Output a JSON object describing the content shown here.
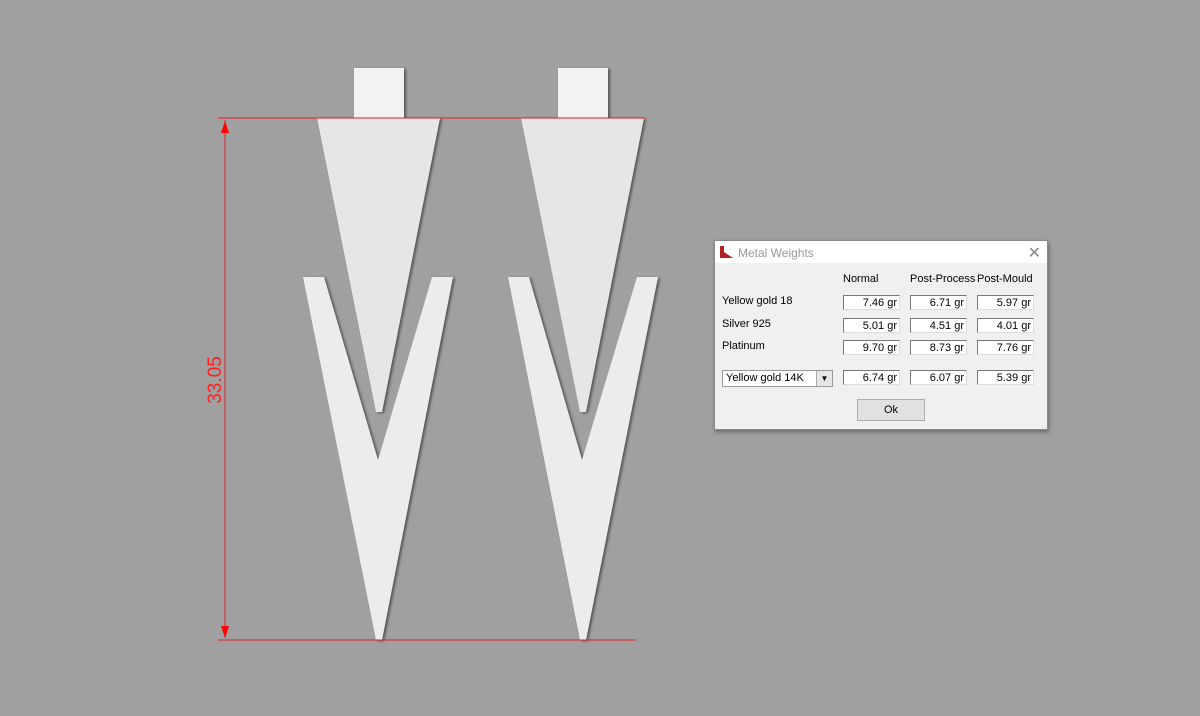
{
  "dimension": {
    "value": "33.05",
    "color": "#ff0000"
  },
  "dialog": {
    "title": "Metal Weights",
    "columns": [
      "Normal",
      "Post-Process",
      "Post-Mould"
    ],
    "rows": [
      {
        "label": "Yellow gold 18",
        "values": [
          "7.46 gr",
          "6.71 gr",
          "5.97 gr"
        ]
      },
      {
        "label": "Silver 925",
        "values": [
          "5.01 gr",
          "4.51 gr",
          "4.01 gr"
        ]
      },
      {
        "label": "Platinum",
        "values": [
          "9.70 gr",
          "8.73 gr",
          "7.76 gr"
        ]
      }
    ],
    "custom": {
      "selected": "Yellow gold 14K",
      "values": [
        "6.74 gr",
        "6.07 gr",
        "5.39 gr"
      ]
    },
    "ok_label": "Ok"
  }
}
